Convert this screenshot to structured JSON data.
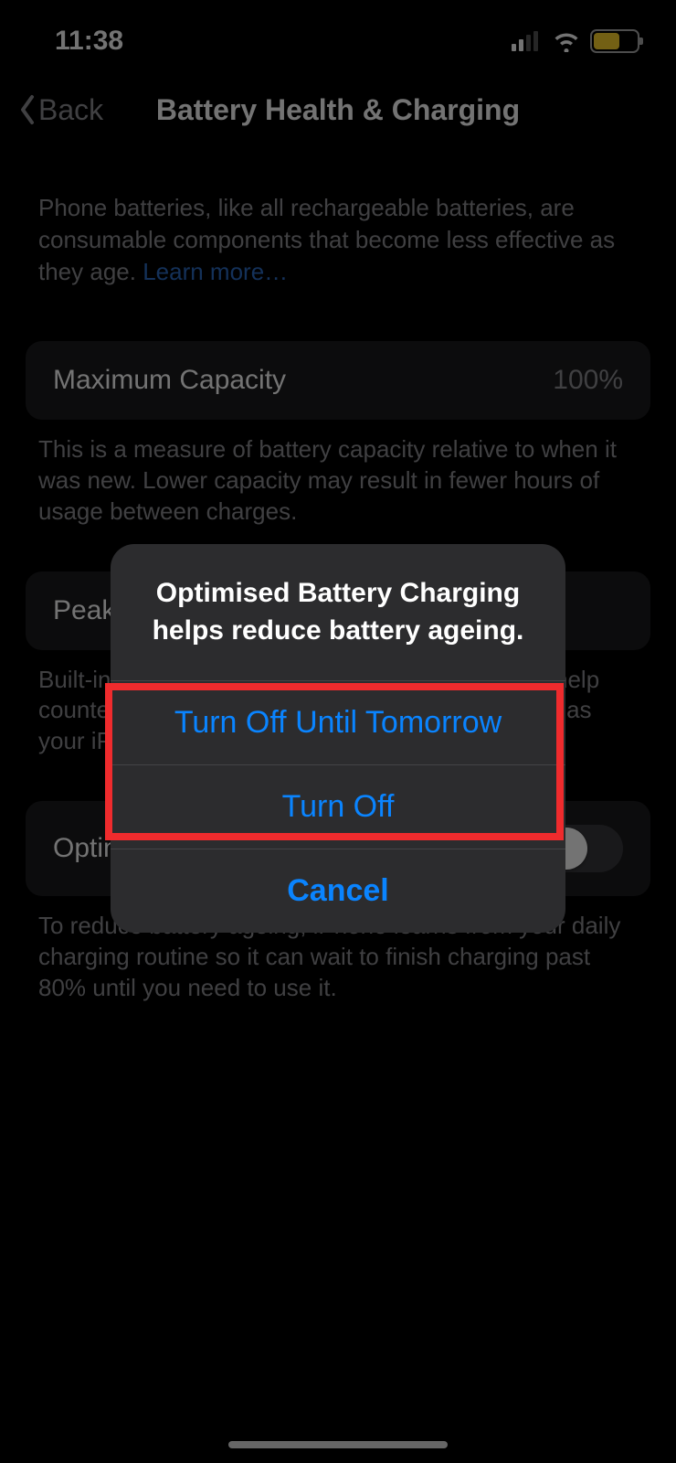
{
  "statusBar": {
    "time": "11:38"
  },
  "nav": {
    "back": "Back",
    "title": "Battery Health & Charging"
  },
  "intro": {
    "text": "Phone batteries, like all rechargeable batteries, are consumable components that become less effective as they age. ",
    "learnMore": "Learn more…"
  },
  "maxCapacity": {
    "label": "Maximum Capacity",
    "value": "100%",
    "footer": "This is a measure of battery capacity relative to when it was new. Lower capacity may result in fewer hours of usage between charges."
  },
  "peak": {
    "label": "Peak Performance Capability",
    "footer": "Built-in dynamic software and hardware systems help counter performance impacts that may be noticed as your iPhone battery chemically ages."
  },
  "optimised": {
    "label": "Optimised Battery Charging",
    "footer": "To reduce battery ageing, iPhone learns from your daily charging routine so it can wait to finish charging past 80% until you need to use it."
  },
  "modal": {
    "title": "Optimised Battery Charging helps reduce battery ageing.",
    "turnOffTomorrow": "Turn Off Until Tomorrow",
    "turnOff": "Turn Off",
    "cancel": "Cancel"
  }
}
